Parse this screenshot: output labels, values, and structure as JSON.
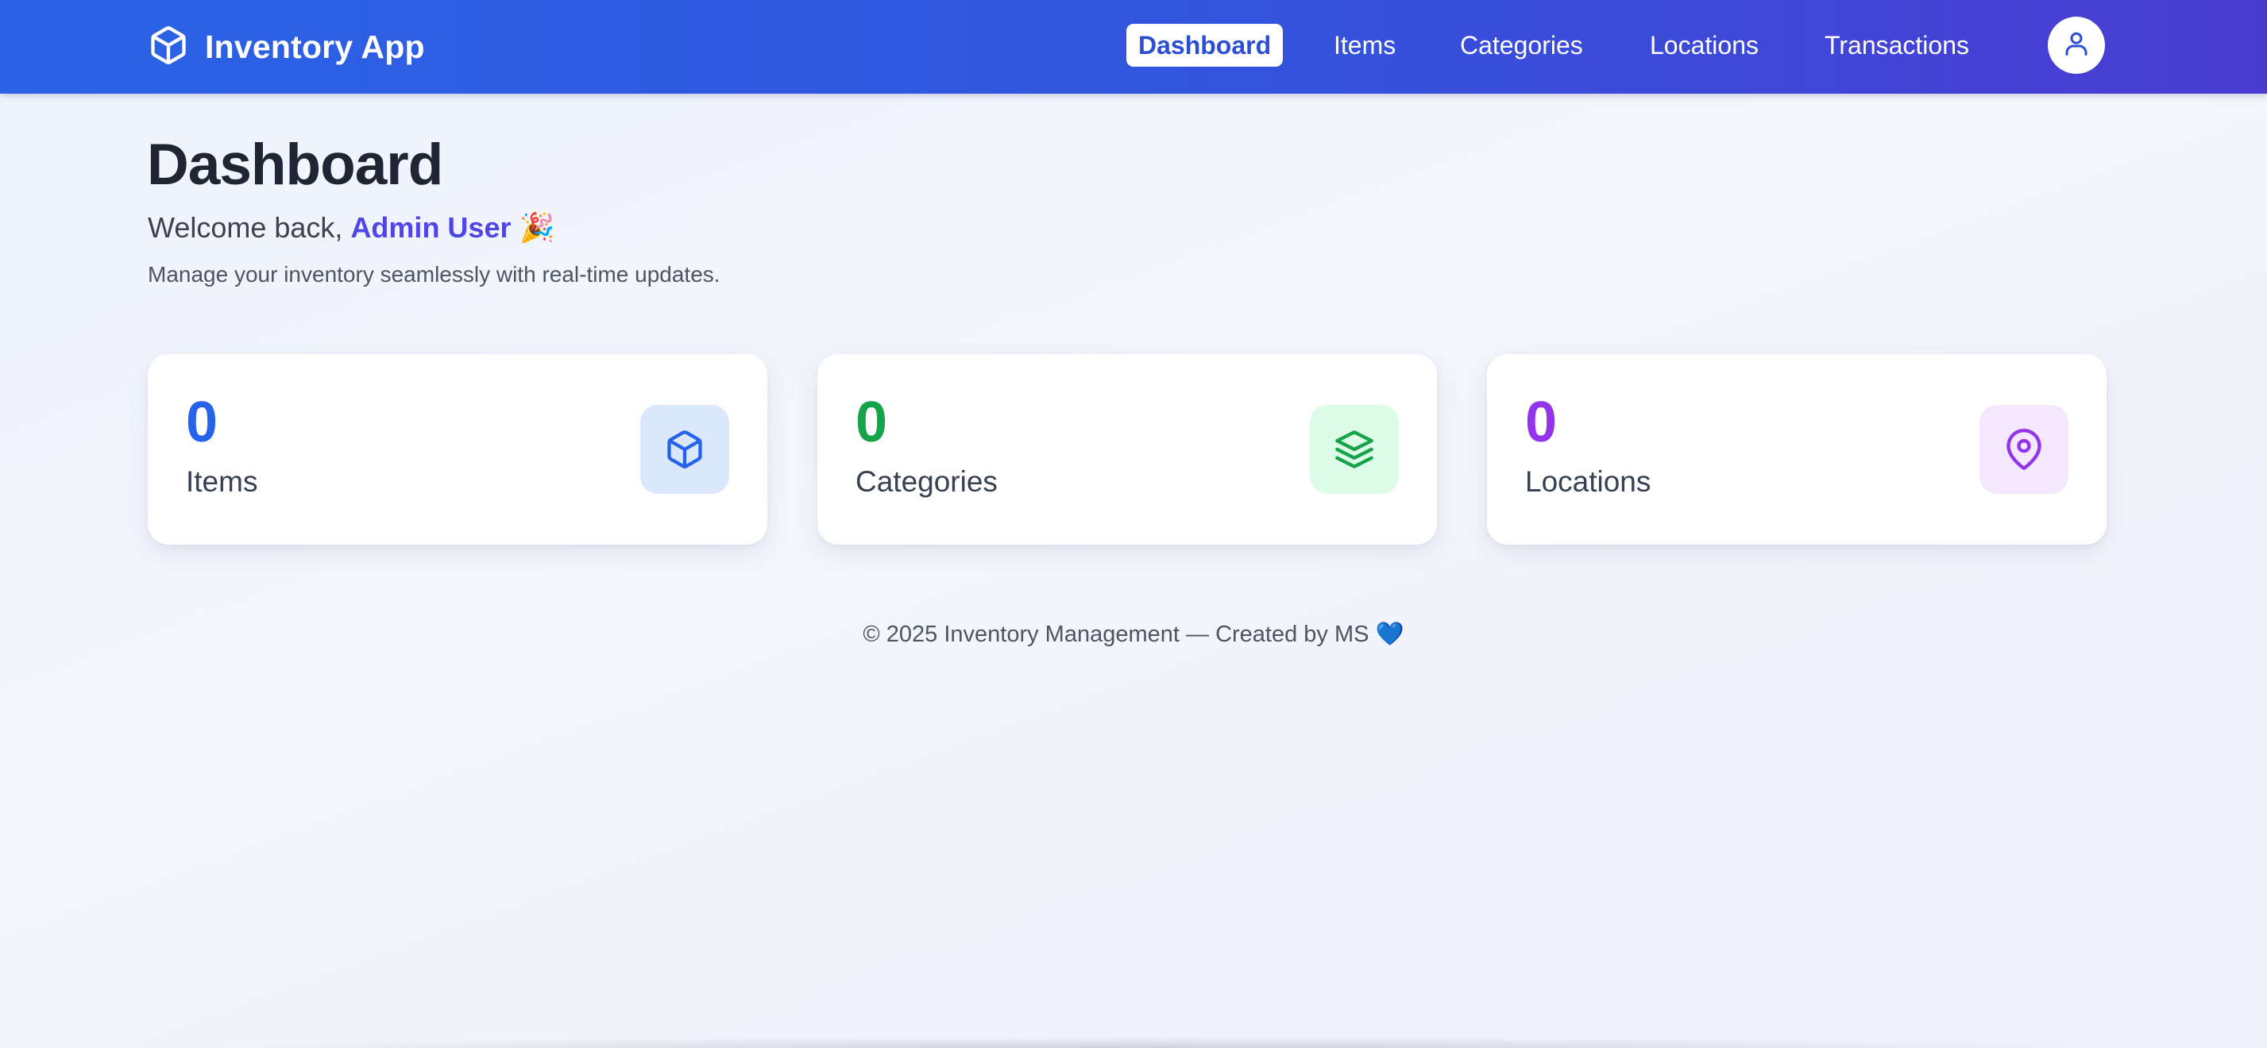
{
  "app": {
    "brand_name": "Inventory App",
    "brand_icon": "cube-icon"
  },
  "nav": {
    "links": [
      {
        "label": "Dashboard",
        "active": true
      },
      {
        "label": "Items",
        "active": false
      },
      {
        "label": "Categories",
        "active": false
      },
      {
        "label": "Locations",
        "active": false
      },
      {
        "label": "Transactions",
        "active": false
      }
    ],
    "user_icon": "user-icon"
  },
  "page": {
    "title": "Dashboard",
    "welcome_prefix": "Welcome back, ",
    "user_name": "Admin User",
    "welcome_emoji": "🎉",
    "subtitle": "Manage your inventory seamlessly with real-time updates."
  },
  "stats": [
    {
      "count": "0",
      "label": "Items",
      "icon": "cube-icon",
      "color": "#2563eb",
      "bg": "#dbe7fd"
    },
    {
      "count": "0",
      "label": "Categories",
      "icon": "layers-icon",
      "color": "#16a34a",
      "bg": "#dcfce7"
    },
    {
      "count": "0",
      "label": "Locations",
      "icon": "map-pin-icon",
      "color": "#9333ea",
      "bg": "#f3e8ff"
    }
  ],
  "footer": {
    "text": "© 2025 Inventory Management — Created by MS 💙"
  },
  "colors": {
    "nav_start": "#2a63e6",
    "nav_end": "#4a3bd0",
    "accent": "#4f46e5"
  }
}
